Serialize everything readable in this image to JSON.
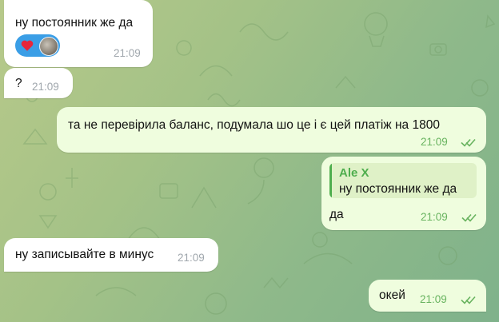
{
  "chat": {
    "background_color": "#a4c287",
    "messages": [
      {
        "direction": "incoming",
        "text": "ну постоянник же да",
        "time": "21:09",
        "reactions": [
          "heart-icon",
          "user-avatar"
        ]
      },
      {
        "direction": "incoming",
        "text": "?",
        "time": "21:09"
      },
      {
        "direction": "outgoing",
        "text": "та не перевірила баланс, подумала шо це і є цей платіж на 1800",
        "time": "21:09",
        "status": "read"
      },
      {
        "direction": "outgoing",
        "reply_to": {
          "author": "Ale X",
          "text": "ну постоянник же да"
        },
        "text": "да",
        "time": "21:09",
        "status": "read"
      },
      {
        "direction": "incoming",
        "text": "ну записывайте в минус",
        "time": "21:09"
      },
      {
        "direction": "outgoing",
        "text": "окей",
        "time": "21:09",
        "status": "read"
      }
    ]
  },
  "colors": {
    "incoming_bubble": "#ffffff",
    "outgoing_bubble": "#effdde",
    "accent_green": "#4fae4e",
    "reaction_chip": "#3a9ee6",
    "heart": "#e8263b"
  }
}
